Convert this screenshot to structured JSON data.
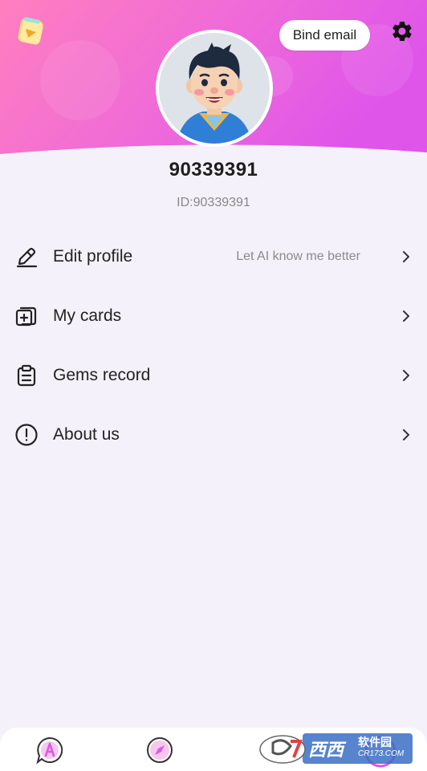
{
  "header": {
    "bind_email_label": "Bind email",
    "gradient_start": "#ff80c0",
    "gradient_end": "#e055e8"
  },
  "profile": {
    "username": "90339391",
    "user_id": "ID:90339391"
  },
  "menu": {
    "items": [
      {
        "label": "Edit profile",
        "hint": "Let AI know me better",
        "icon": "edit-pencil-icon"
      },
      {
        "label": "My cards",
        "hint": "",
        "icon": "card-add-icon"
      },
      {
        "label": "Gems record",
        "hint": "",
        "icon": "clipboard-icon"
      },
      {
        "label": "About us",
        "hint": "",
        "icon": "info-circle-icon"
      }
    ]
  },
  "bottom_nav": {
    "items": [
      {
        "icon": "chat-a-icon"
      },
      {
        "icon": "compass-icon"
      },
      {
        "icon": "profile-icon"
      }
    ],
    "accent": "#e055e8"
  },
  "watermark": {
    "line1": "西西",
    "line2": "软件园",
    "line3": "CR173.COM"
  }
}
